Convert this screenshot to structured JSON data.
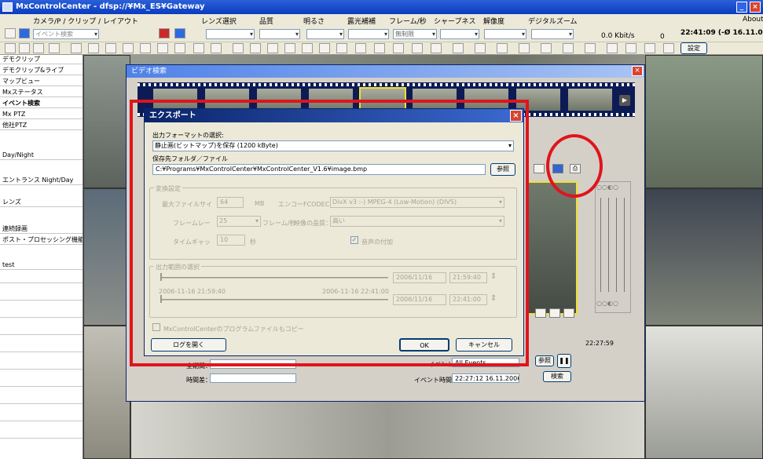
{
  "window": {
    "title": "MxControlCenter - dfsp://¥Mx_ES¥Gateway"
  },
  "menus": [
    "カメラ/P / クリップ / レイアウト",
    "レンズ選択",
    "品質",
    "明るさ",
    "露光補補",
    "フレーム/秒",
    "シャープネス",
    "解像度",
    "デジタルズーム",
    "About"
  ],
  "toolbar": {
    "search_placeholder": "イベント検索",
    "select_value": "無制限",
    "bitrate": "0.0 Kbit/s",
    "bitrate_count": "0",
    "clock": "22:41:09 (-Ø 16.11.06",
    "settings_label": "設定"
  },
  "sidebar": {
    "items": [
      "デモクリップ",
      "デモクリップ&ライブ",
      "マップビュー",
      "Mxステータス",
      "イベント検索",
      "Mx PTZ",
      "他社PTZ",
      "Day/Night",
      "エントランス Night/Day",
      "レンズ",
      "連続録画",
      "ポスト・プロセッシング機能",
      "test"
    ]
  },
  "video_search": {
    "title": "ビデオ検索",
    "time_display": "22:27:59",
    "label_start": "全期間：",
    "label_time": "時間差：",
    "label_event": "イベント：",
    "event_value": "All Events",
    "label_event_time": "イベント時間：",
    "event_time_value": "22:27:12 16.11.2006",
    "btn_ref": "参照",
    "btn_search": "検索"
  },
  "export": {
    "title": "エクスポート",
    "format_label": "出力フォーマットの選択:",
    "format_value": "静止画(ビットマップ)を保存 (1200 kByte)",
    "folder_label": "保存先フォルダ／ファイル",
    "folder_value": "C:¥Programs¥MxControlCenter¥MxControlCenter_V1.6¥image.bmp",
    "browse_button": "参照",
    "convert_group": "変換設定",
    "max_file_size_label": "最大ファイルサイ",
    "max_file_size_value": "64",
    "max_file_size_unit": "MB",
    "encoder_label": "エンコーFCODEC",
    "encoder_value": "DivX v3 :-) MPEG-4 (Low-Motion) (DIVS)",
    "framerate_label": "フレームレー",
    "framerate_value": "25",
    "framerate_unit": "フレーム/秒",
    "quality_label": "映像の品質：",
    "quality_value": "高い",
    "timegap_label": "タイムギャッ",
    "timegap_value": "10",
    "timegap_unit": "秒",
    "audio_label": "音声の付加",
    "range_group": "出力範囲の選択",
    "start_date": "2006/11/16",
    "start_time": "21:59:40",
    "range_left": "2006-11-16 21:59:40",
    "range_right": "2006-11-16 22:41:00",
    "end_date": "2006/11/16",
    "end_time": "22:41:00",
    "copy_program_label": "MxControlCenterのプログラムファイルもコピー",
    "log_button": "ログを開く",
    "ok_button": "OK",
    "cancel_button": "キャンセル"
  }
}
